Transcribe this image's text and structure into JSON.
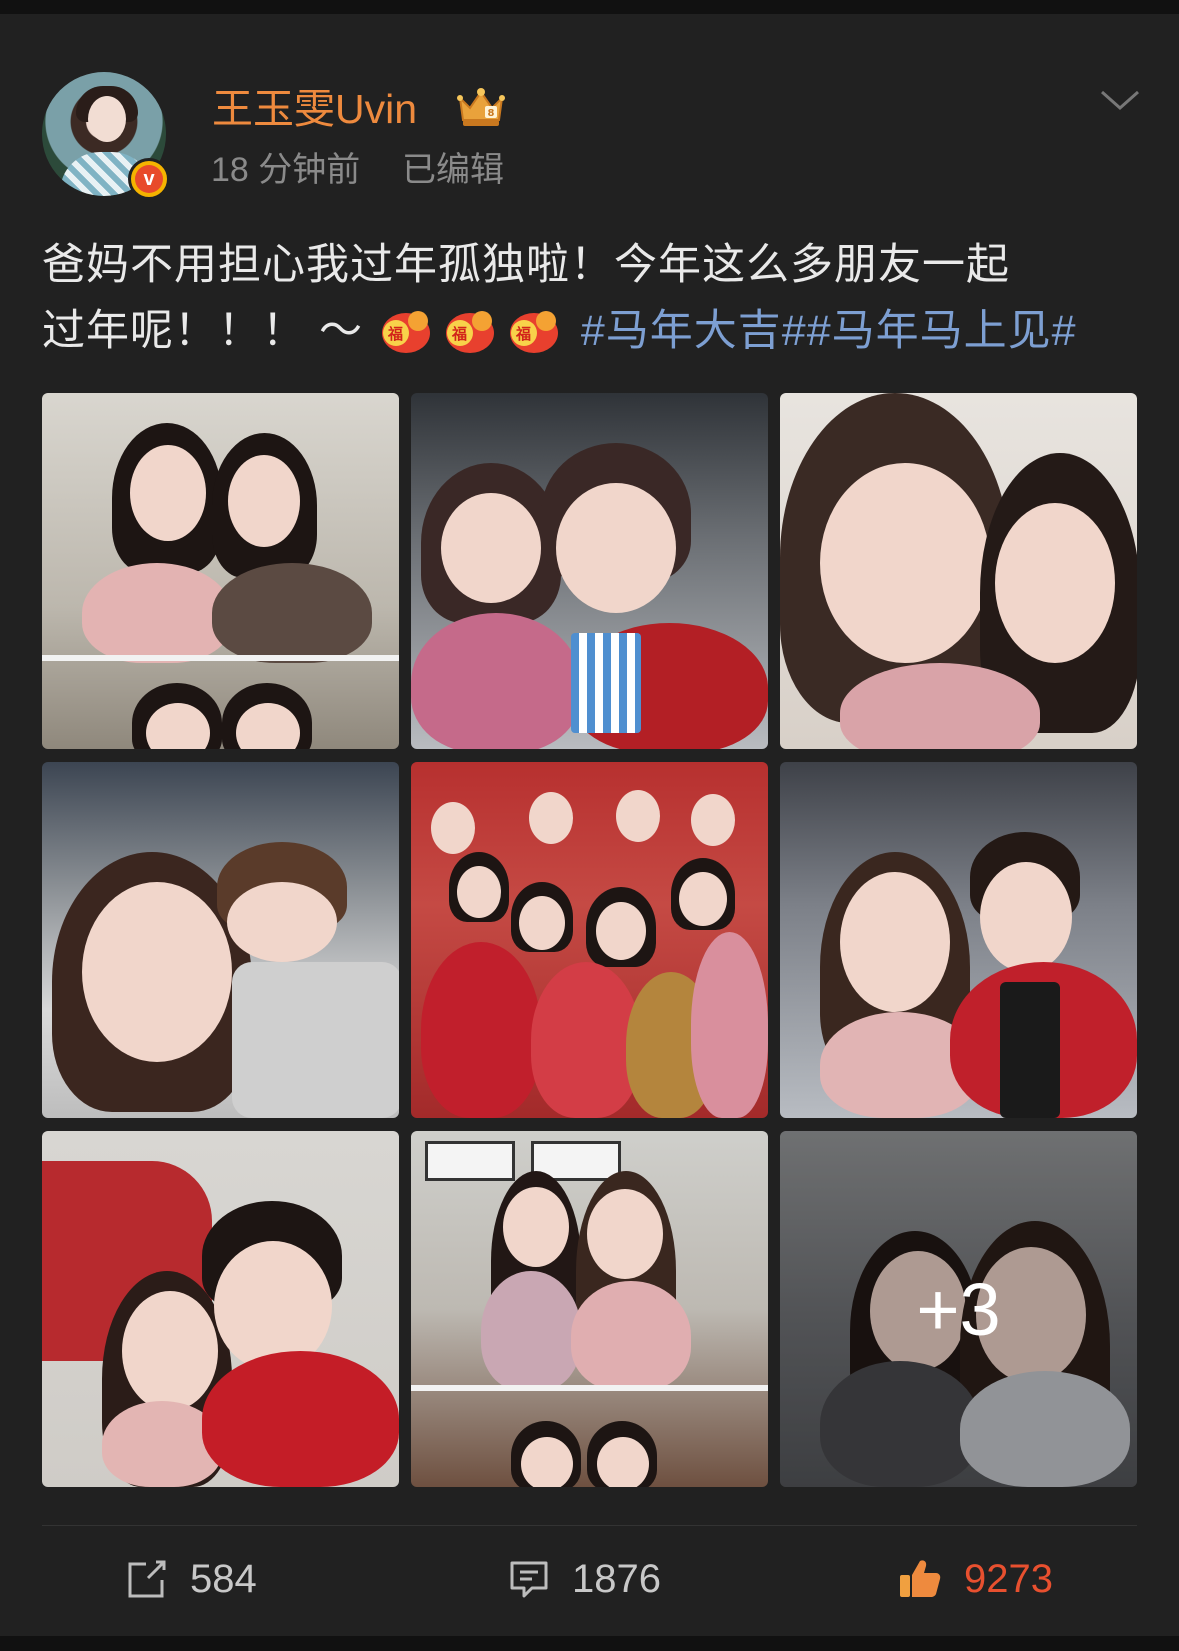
{
  "post": {
    "username": "王玉雯Uvin",
    "time": "18 分钟前",
    "edited": "已编辑",
    "text_line1": "爸妈不用担心我过年孤独啦！今年这么多朋友一起",
    "text_line2_prefix": "过年呢！！！ ～",
    "hashtags": "#马年大吉##马年马上见#",
    "more_photos": "+3"
  },
  "actions": {
    "repost_count": "584",
    "comment_count": "1876",
    "like_count": "9273"
  },
  "colors": {
    "username": "#ee8a3e",
    "hashtag": "#7d9fd2",
    "like": "#e8502f",
    "background": "#212121"
  }
}
